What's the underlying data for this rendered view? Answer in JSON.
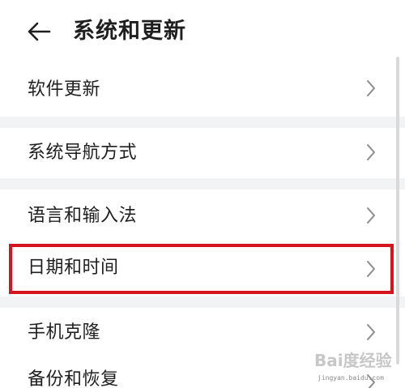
{
  "header": {
    "title": "系统和更新"
  },
  "items": [
    {
      "label": "软件更新"
    },
    {
      "label": "系统导航方式"
    },
    {
      "label": "语言和输入法"
    },
    {
      "label": "日期和时间"
    },
    {
      "label": "手机克隆"
    },
    {
      "label": "备份和恢复"
    }
  ],
  "colors": {
    "highlight": "#d6141c",
    "background": "#f1f3f5",
    "row": "#ffffff"
  },
  "watermark": {
    "text": "Bai度经验",
    "sub": "jingyan.baidu.com"
  }
}
